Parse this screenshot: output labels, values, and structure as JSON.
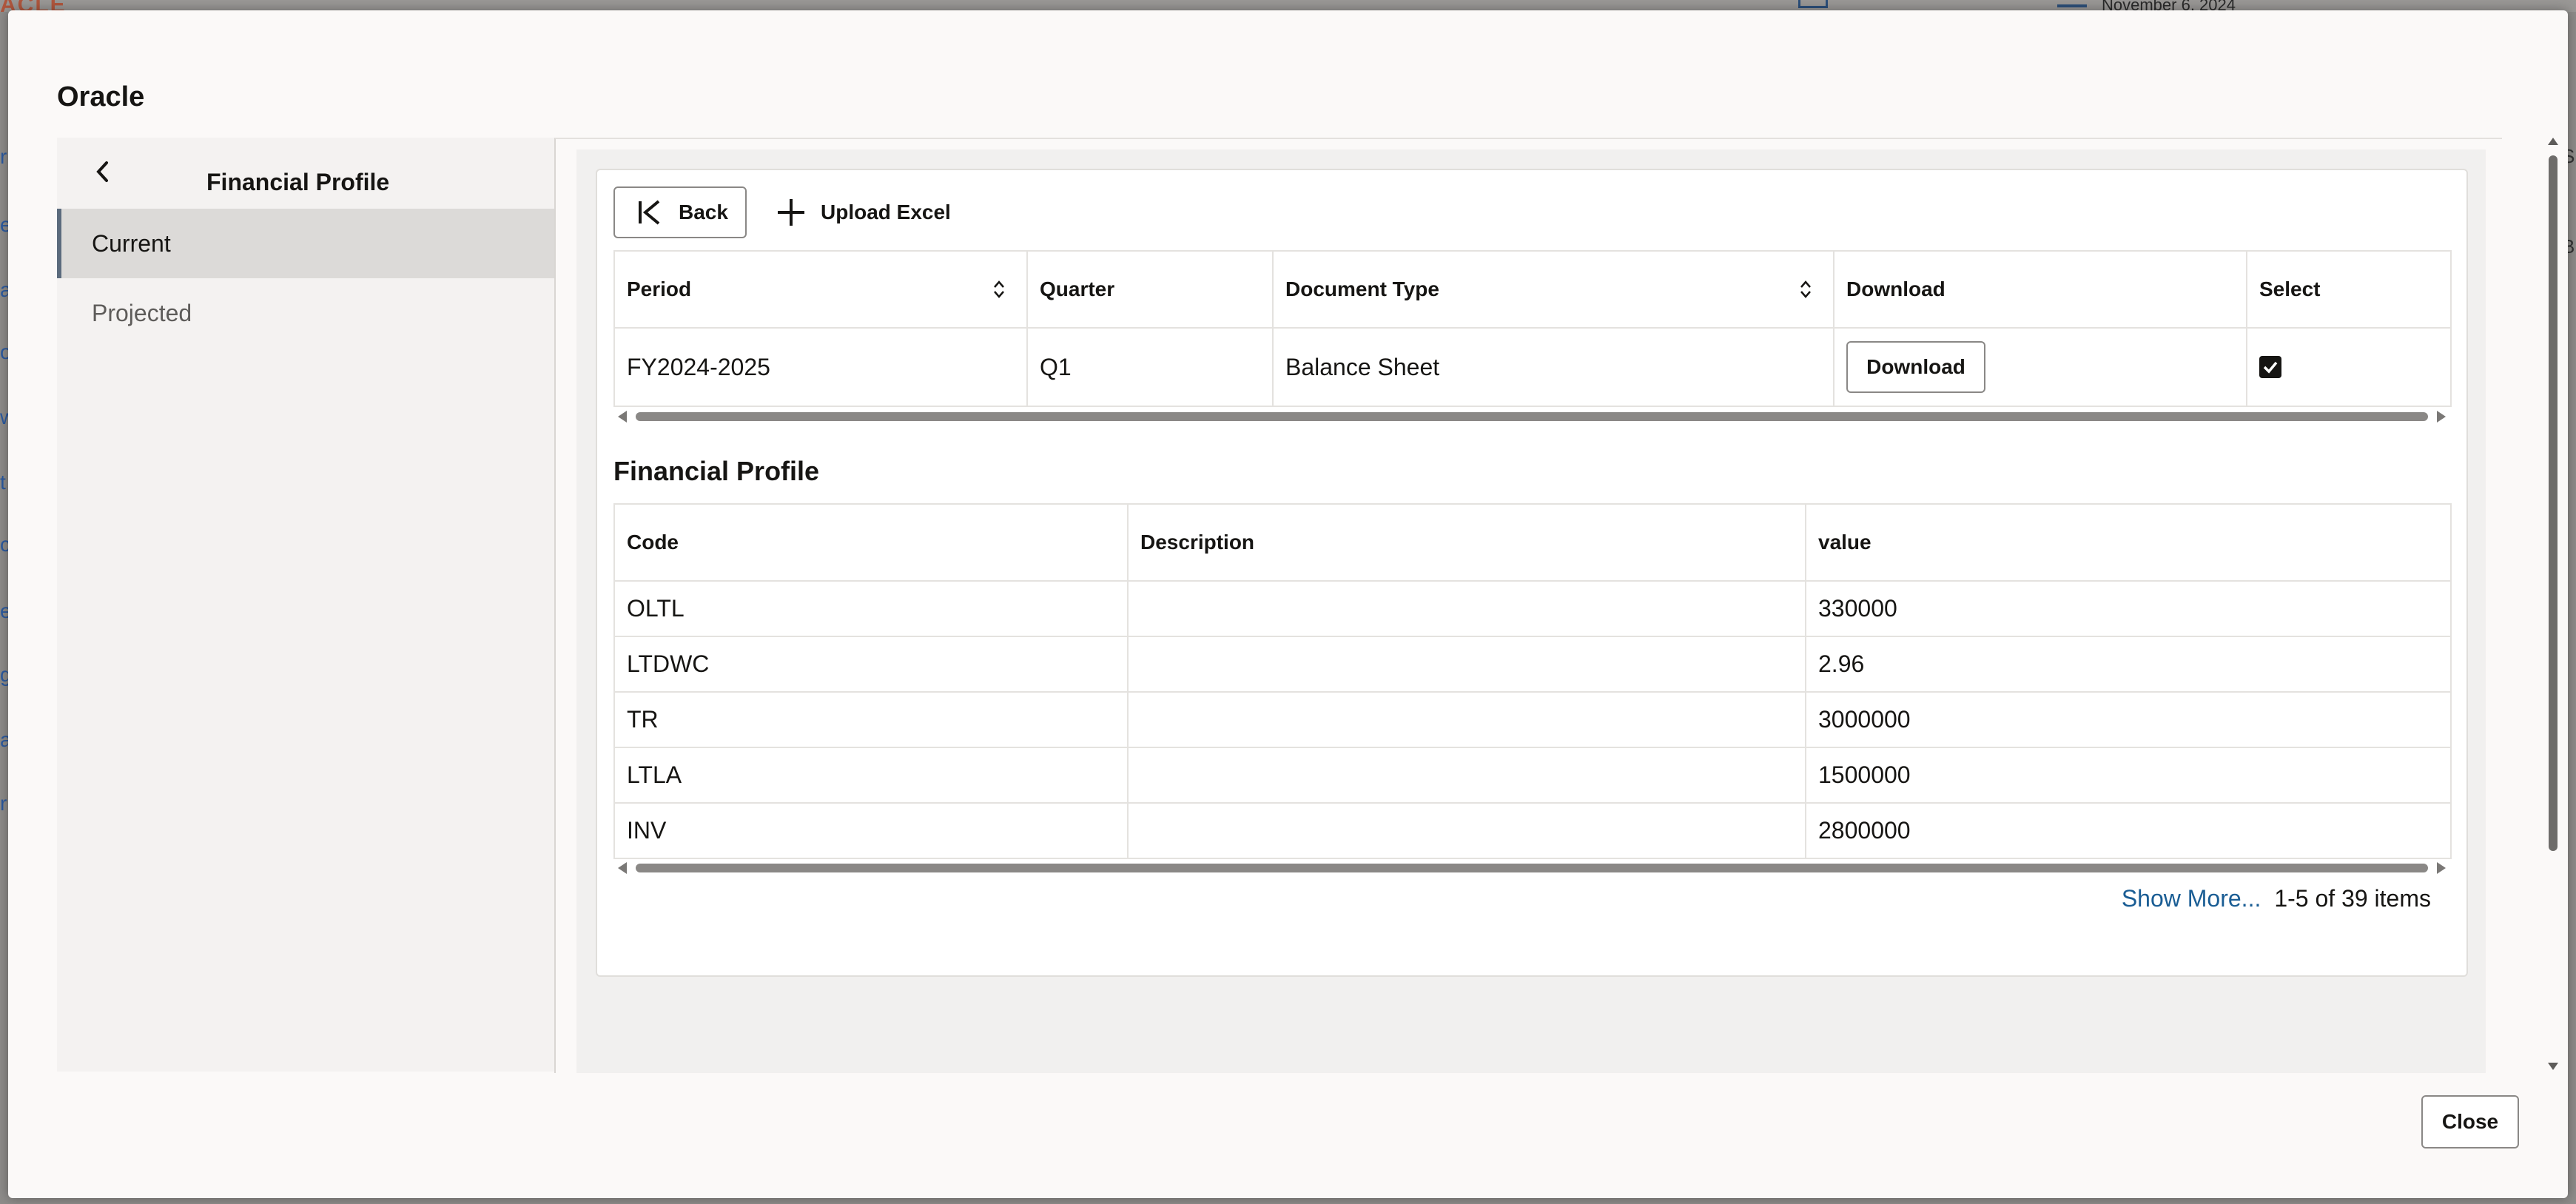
{
  "background": {
    "app_logo": "ACLE",
    "date_text": "November 6, 2024",
    "left_fragments": [
      "r",
      "e",
      "a",
      "o",
      "w",
      "t",
      "c",
      "e",
      "g",
      "a",
      "r"
    ],
    "right_fragments": [
      "S",
      "B"
    ]
  },
  "dialog": {
    "title": "Oracle",
    "close_label": "Close"
  },
  "nav": {
    "title": "Financial Profile",
    "items": [
      {
        "label": "Current",
        "active": true
      },
      {
        "label": "Projected",
        "active": false
      }
    ]
  },
  "toolbar": {
    "back_label": "Back",
    "upload_label": "Upload Excel"
  },
  "documents_table": {
    "columns": [
      "Period",
      "Quarter",
      "Document Type",
      "Download",
      "Select"
    ],
    "rows": [
      {
        "period": "FY2024-2025",
        "quarter": "Q1",
        "document_type": "Balance Sheet",
        "download_label": "Download",
        "selected": true
      }
    ]
  },
  "profile": {
    "title": "Financial Profile",
    "columns": [
      "Code",
      "Description",
      "value"
    ],
    "rows": [
      {
        "code": "OLTL",
        "description": "",
        "value": "330000"
      },
      {
        "code": "LTDWC",
        "description": "",
        "value": "2.96"
      },
      {
        "code": "TR",
        "description": "",
        "value": "3000000"
      },
      {
        "code": "LTLA",
        "description": "",
        "value": "1500000"
      },
      {
        "code": "INV",
        "description": "",
        "value": "2800000"
      }
    ],
    "show_more_label": "Show More...",
    "item_count": "1-5 of 39 items"
  },
  "colors": {
    "accent_link": "#1a5d94",
    "active_nav_bar": "#5b6b7d"
  }
}
